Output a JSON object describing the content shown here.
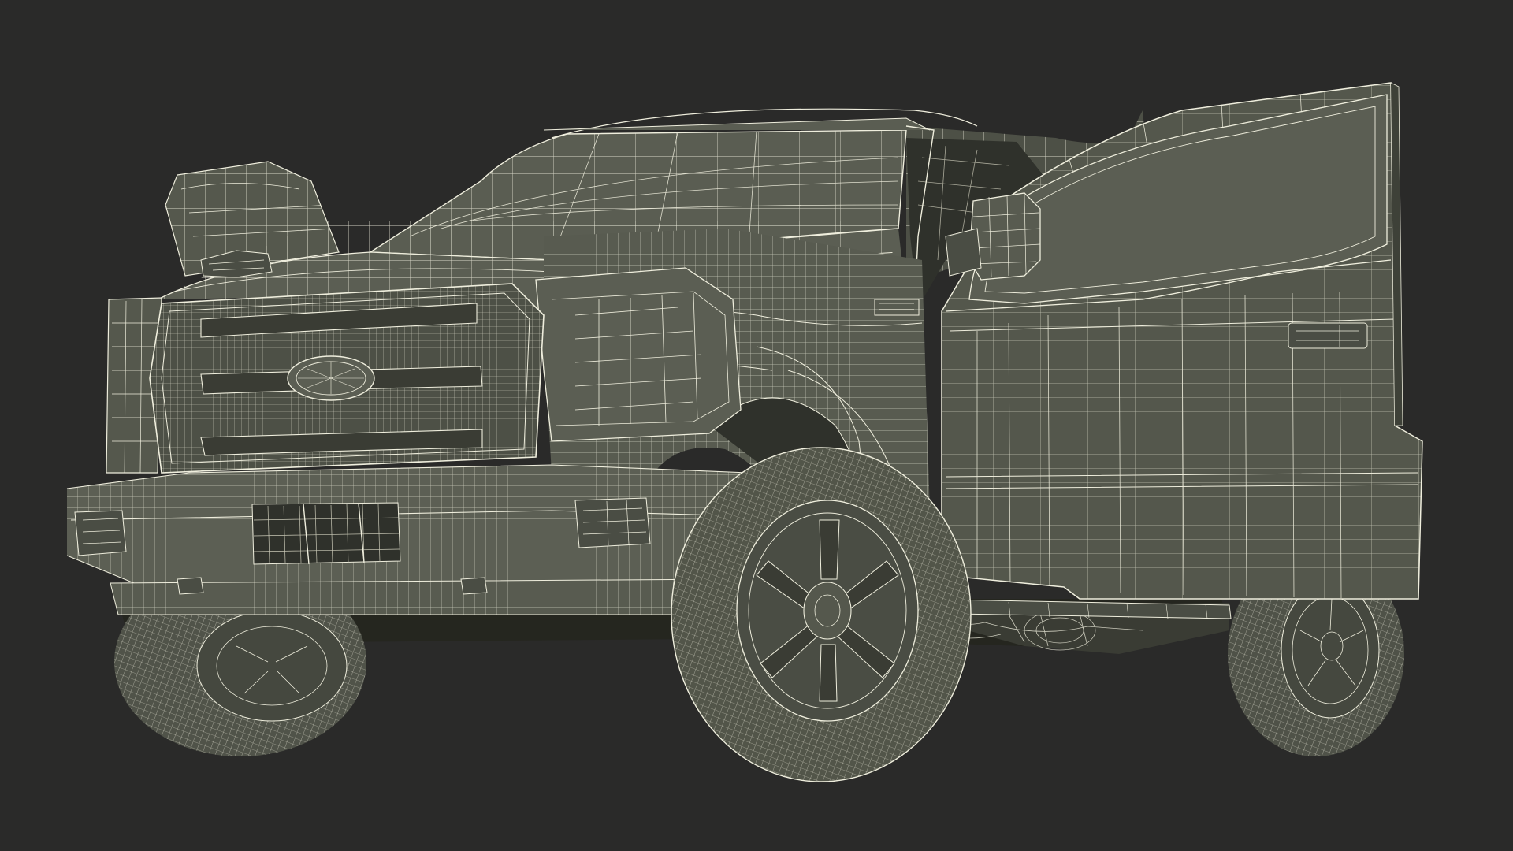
{
  "scene": {
    "background_color": "#2a2a29",
    "body_color": "#54574c",
    "body_shadow_color": "#3e4138",
    "dark_interior_color": "#33352f",
    "wire_color": "#efeedd",
    "wire_faint_color": "#c9c8b6"
  }
}
